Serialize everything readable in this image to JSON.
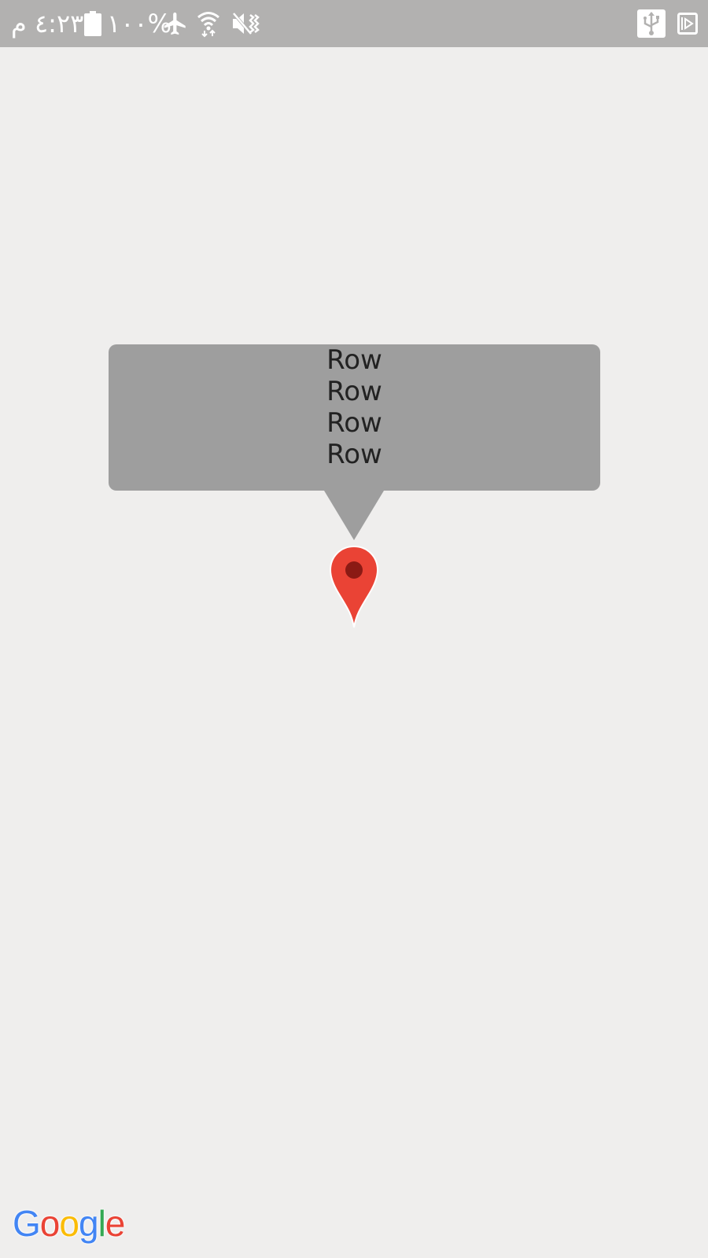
{
  "status_bar": {
    "time": "٤:٢٣ م",
    "battery_percent": "%١٠٠",
    "icons": [
      "battery-icon",
      "airplane-mode-icon",
      "wifi-icon",
      "vibrate-mute-icon",
      "usb-icon",
      "screen-record-icon"
    ]
  },
  "map": {
    "info_window": {
      "rows": [
        "Row",
        "Row",
        "Row",
        "Row"
      ]
    },
    "marker": {
      "icon": "map-pin-icon",
      "color": "#ea4335",
      "dot_color": "#8b1a14"
    },
    "attribution": {
      "letters": [
        "G",
        "o",
        "o",
        "g",
        "l",
        "e"
      ],
      "colors": [
        "#4285f4",
        "#ea4335",
        "#fbbc05",
        "#4285f4",
        "#34a853",
        "#ea4335"
      ]
    }
  },
  "colors": {
    "status_bar_bg": "#b2b1b0",
    "map_bg": "#efeeed",
    "info_window_bg": "#9e9e9e"
  }
}
